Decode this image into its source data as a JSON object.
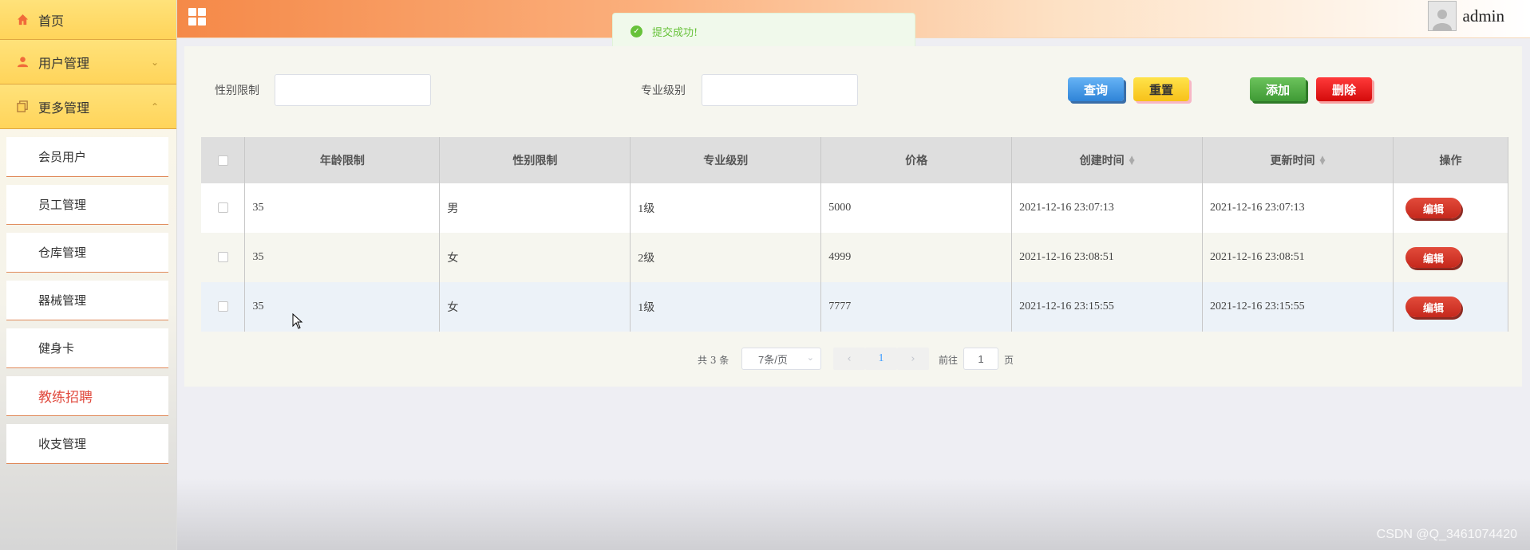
{
  "sidebar": {
    "home_label": "首页",
    "user_mgmt_label": "用户管理",
    "more_mgmt_label": "更多管理",
    "items": [
      {
        "label": "会员用户"
      },
      {
        "label": "员工管理"
      },
      {
        "label": "仓库管理"
      },
      {
        "label": "器械管理"
      },
      {
        "label": "健身卡"
      },
      {
        "label": "教练招聘"
      },
      {
        "label": "收支管理"
      }
    ],
    "active_index": 5
  },
  "header": {
    "username": "admin"
  },
  "toast": {
    "message": "提交成功!"
  },
  "filters": {
    "gender_label": "性别限制",
    "gender_value": "",
    "level_label": "专业级别",
    "level_value": ""
  },
  "buttons": {
    "search": "查询",
    "reset": "重置",
    "add": "添加",
    "delete": "删除"
  },
  "table": {
    "headers": [
      "年龄限制",
      "性别限制",
      "专业级别",
      "价格",
      "创建时间",
      "更新时间",
      "操作"
    ],
    "rows": [
      {
        "age": "35",
        "gender": "男",
        "level": "1级",
        "price": "5000",
        "created": "2021-12-16 23:07:13",
        "updated": "2021-12-16 23:07:13",
        "action": "编辑"
      },
      {
        "age": "35",
        "gender": "女",
        "level": "2级",
        "price": "4999",
        "created": "2021-12-16 23:08:51",
        "updated": "2021-12-16 23:08:51",
        "action": "编辑"
      },
      {
        "age": "35",
        "gender": "女",
        "level": "1级",
        "price": "7777",
        "created": "2021-12-16 23:15:55",
        "updated": "2021-12-16 23:15:55",
        "action": "编辑"
      }
    ]
  },
  "pagination": {
    "total_text": "共 3 条",
    "page_size": "7条/页",
    "current_page": "1",
    "goto_prefix": "前往",
    "goto_value": "1",
    "goto_suffix": "页"
  },
  "watermark": "CSDN @Q_3461074420",
  "colors": {
    "sidebar_header": "#ffd45a",
    "active_item": "#e0493d",
    "header_start": "#f58948",
    "success": "#67c23a",
    "edit_button": "#d8362a"
  }
}
